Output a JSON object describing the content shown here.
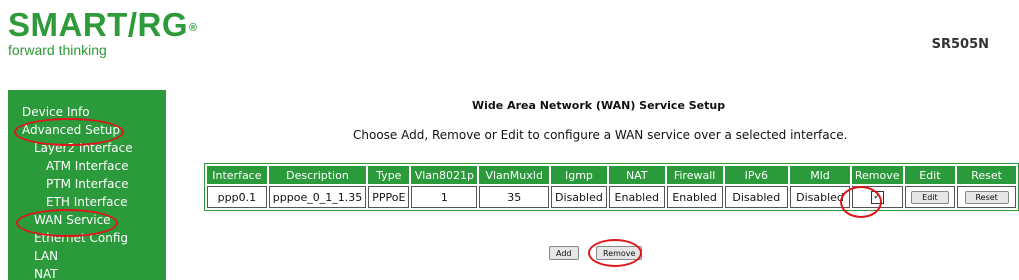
{
  "brand": {
    "name": "SMART/RG",
    "reg": "®",
    "tagline": "forward thinking",
    "color": "#2e9a39"
  },
  "model": "SR505N",
  "sidebar": {
    "items": [
      {
        "label": "Device Info"
      },
      {
        "label": "Advanced Setup"
      },
      {
        "label": "Layer2 Interface"
      },
      {
        "label": "ATM Interface"
      },
      {
        "label": "PTM Interface"
      },
      {
        "label": "ETH Interface"
      },
      {
        "label": "WAN Service"
      },
      {
        "label": "Ethernet Config"
      },
      {
        "label": "LAN"
      },
      {
        "label": "NAT"
      }
    ]
  },
  "page": {
    "title": "Wide Area Network (WAN) Service Setup",
    "subtitle": "Choose Add, Remove or Edit to configure a WAN service over a selected interface."
  },
  "table": {
    "headers": [
      "Interface",
      "Description",
      "Type",
      "Vlan8021p",
      "VlanMuxId",
      "Igmp",
      "NAT",
      "Firewall",
      "IPv6",
      "Mld",
      "Remove",
      "Edit",
      "Reset"
    ],
    "rows": [
      {
        "interface": "ppp0.1",
        "description": "pppoe_0_1_1.35",
        "type": "PPPoE",
        "vlan8021p": "1",
        "vlanmuxid": "35",
        "igmp": "Disabled",
        "nat": "Enabled",
        "firewall": "Enabled",
        "ipv6": "Disabled",
        "mld": "Disabled",
        "remove_checked": true,
        "check_glyph": "✓",
        "edit_label": "Edit",
        "reset_label": "Reset"
      }
    ]
  },
  "actions": {
    "add_label": "Add",
    "remove_label": "Remove"
  },
  "colors": {
    "sidebar_bg": "#2b9a3a",
    "header_bg": "#2b9a3a",
    "annotation": "#e0151b"
  }
}
